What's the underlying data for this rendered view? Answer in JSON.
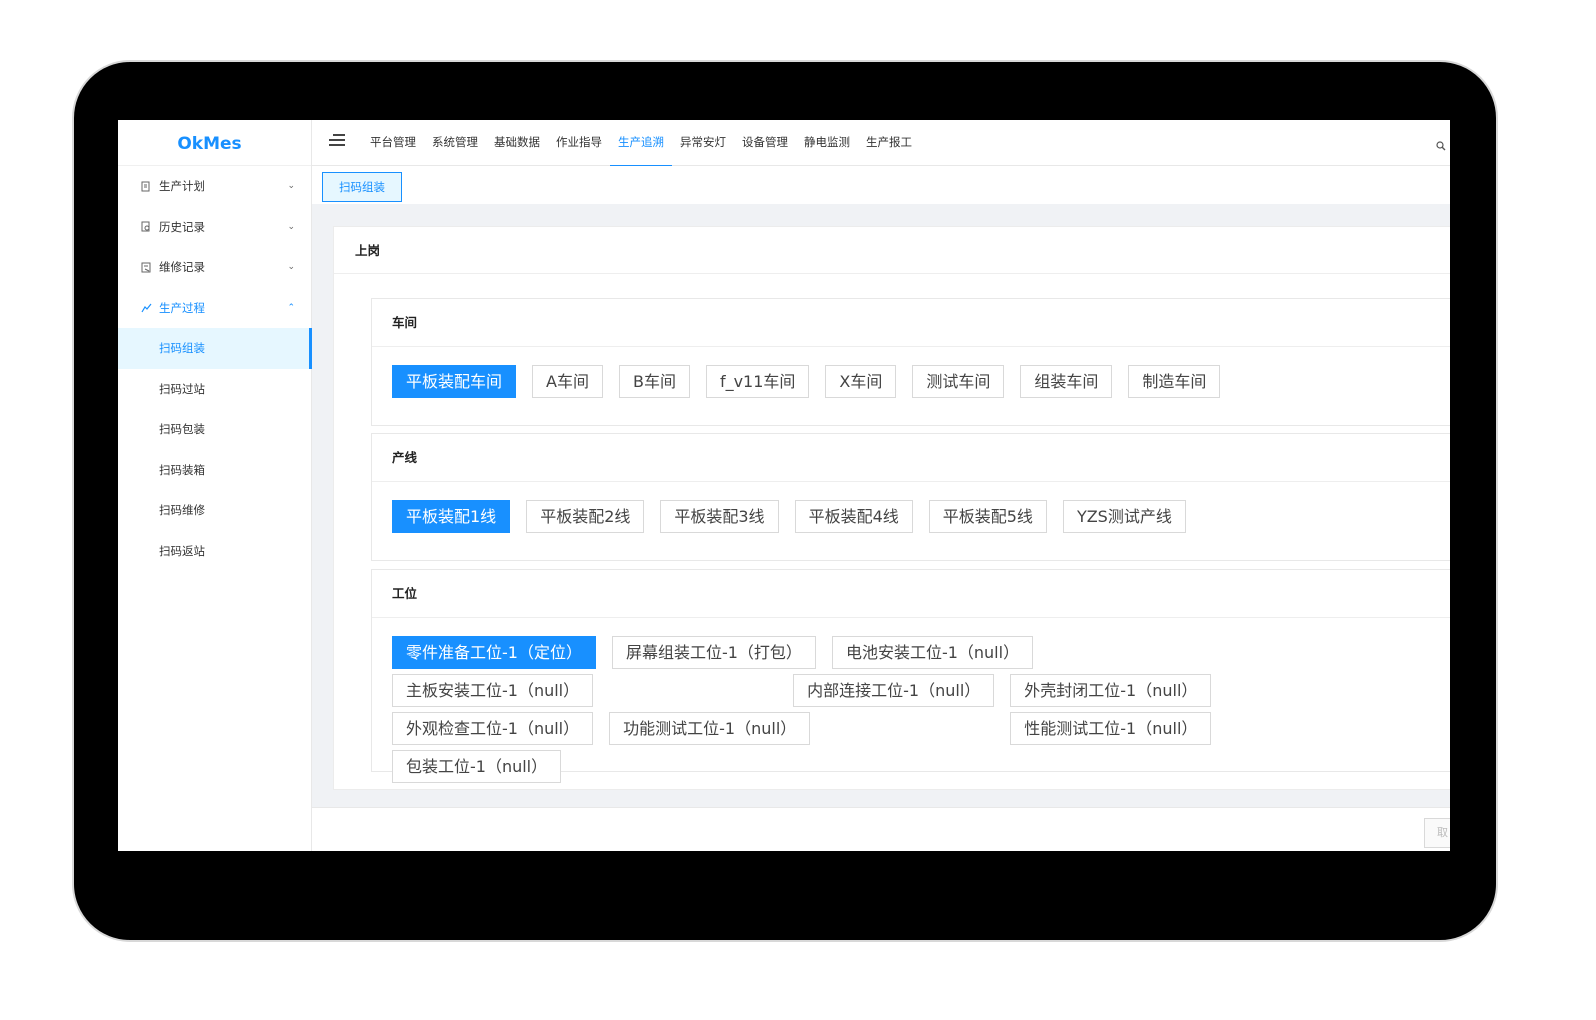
{
  "app": {
    "title": "OkMes"
  },
  "sidebar": {
    "items": [
      {
        "label": "生产计划",
        "icon": "document-icon",
        "expanded": false
      },
      {
        "label": "历史记录",
        "icon": "history-icon",
        "expanded": false
      },
      {
        "label": "维修记录",
        "icon": "repair-icon",
        "expanded": false
      },
      {
        "label": "生产过程",
        "icon": "trend-icon",
        "expanded": true
      }
    ],
    "subitems": [
      "扫码组装",
      "扫码过站",
      "扫码包装",
      "扫码装箱",
      "扫码维修",
      "扫码返站"
    ],
    "active_subitem": "扫码组装"
  },
  "topnav": {
    "items": [
      "平台管理",
      "系统管理",
      "基础数据",
      "作业指导",
      "生产追溯",
      "异常安灯",
      "设备管理",
      "静电监测",
      "生产报工"
    ],
    "active": "生产追溯"
  },
  "tabs": {
    "current": "扫码组装"
  },
  "card": {
    "title": "上岗"
  },
  "sections": {
    "workshop": {
      "title": "车间",
      "options": [
        "平板装配车间",
        "A车间",
        "B车间",
        "f_v11车间",
        "X车间",
        "测试车间",
        "组装车间",
        "制造车间"
      ],
      "selected": "平板装配车间"
    },
    "line": {
      "title": "产线",
      "options": [
        "平板装配1线",
        "平板装配2线",
        "平板装配3线",
        "平板装配4线",
        "平板装配5线",
        "YZS测试产线"
      ],
      "selected": "平板装配1线"
    },
    "station": {
      "title": "工位",
      "options": [
        "零件准备工位-1（定位）",
        "屏幕组装工位-1（打包）",
        "电池安装工位-1（null）",
        "主板安装工位-1（null）",
        "内部连接工位-1（null）",
        "外壳封闭工位-1（null）",
        "外观检查工位-1（null）",
        "功能测试工位-1（null）",
        "性能测试工位-1（null）",
        "包装工位-1（null）"
      ],
      "selected": "零件准备工位-1（定位）"
    }
  },
  "footer": {
    "cancel_label": "取"
  },
  "colors": {
    "accent": "#1890ff",
    "device": "#000000"
  }
}
